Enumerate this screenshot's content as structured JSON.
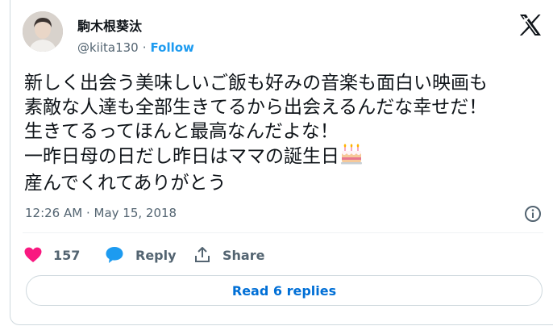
{
  "tweet": {
    "author": {
      "name": "駒木根葵汰",
      "handle": "@kiita130",
      "follow_label": "Follow",
      "separator": "·"
    },
    "body_lines": [
      "新しく出会う美味しいご飯も好みの音楽も面白い映画も",
      "素敵な人達も全部生きてるから出会えるんだな幸せだ！",
      "生きてるってほんと最高なんだよな！",
      "一昨日母の日だし昨日はママの誕生日",
      "産んでくれてありがとう"
    ],
    "timestamp": "12:26 AM · May 15, 2018",
    "actions": {
      "like_count": "157",
      "reply_label": "Reply",
      "share_label": "Share"
    },
    "read_replies_label": "Read 6 replies"
  },
  "colors": {
    "accent": "#1d9bf0",
    "like": "#f91880",
    "text": "#0f1419",
    "muted": "#536471",
    "border": "#cfd9de"
  },
  "icons": [
    "x-logo-icon",
    "info-icon",
    "heart-icon",
    "reply-bubble-icon",
    "share-icon",
    "birthday-cake-icon"
  ]
}
